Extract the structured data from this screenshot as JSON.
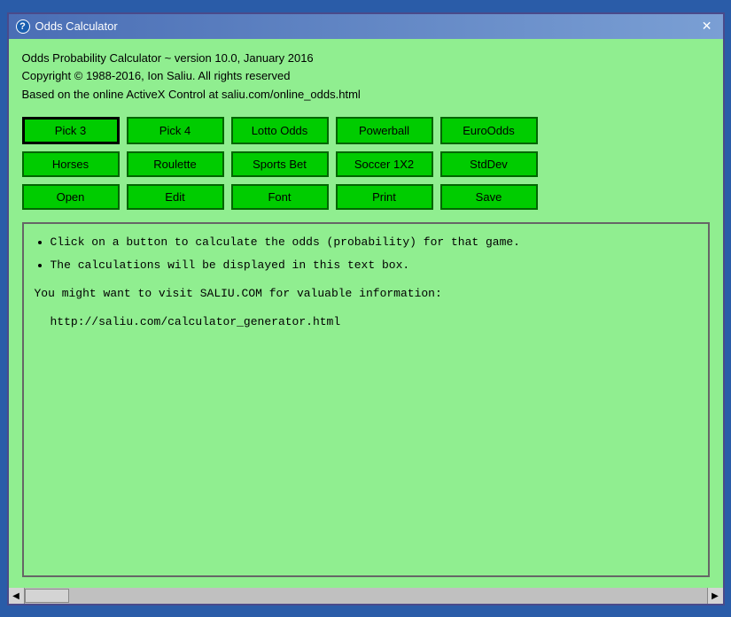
{
  "window": {
    "title": "Odds Calculator",
    "close_label": "✕"
  },
  "header": {
    "line1": "Odds Probability Calculator ~ version 10.0, January 2016",
    "line2": "Copyright © 1988-2016, Ion Saliu. All rights reserved",
    "line3": "Based on the online ActiveX Control at saliu.com/online_odds.html"
  },
  "buttons": {
    "row1": [
      {
        "label": "Pick 3",
        "name": "pick3-button",
        "active": true
      },
      {
        "label": "Pick 4",
        "name": "pick4-button"
      },
      {
        "label": "Lotto Odds",
        "name": "lotto-odds-button"
      },
      {
        "label": "Powerball",
        "name": "powerball-button"
      },
      {
        "label": "EuroOdds",
        "name": "euro-odds-button"
      }
    ],
    "row2": [
      {
        "label": "Horses",
        "name": "horses-button"
      },
      {
        "label": "Roulette",
        "name": "roulette-button"
      },
      {
        "label": "Sports Bet",
        "name": "sports-bet-button"
      },
      {
        "label": "Soccer 1X2",
        "name": "soccer-button"
      },
      {
        "label": "StdDev",
        "name": "stddev-button"
      }
    ],
    "row3": [
      {
        "label": "Open",
        "name": "open-button"
      },
      {
        "label": "Edit",
        "name": "edit-button"
      },
      {
        "label": "Font",
        "name": "font-button"
      },
      {
        "label": "Print",
        "name": "print-button"
      },
      {
        "label": "Save",
        "name": "save-button"
      }
    ]
  },
  "text_area": {
    "bullet1": "Click on a button to calculate the odds (probability) for that game.",
    "bullet2": "The calculations will be displayed in this text box.",
    "bullet3": "You might want to visit SALIU.COM for valuable information:",
    "link": "http://saliu.com/calculator_generator.html"
  }
}
